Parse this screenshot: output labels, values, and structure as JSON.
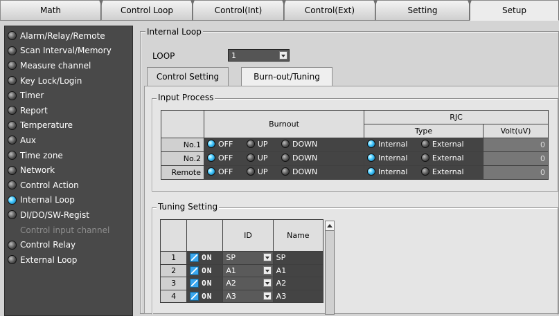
{
  "tabs": [
    {
      "label": "Math"
    },
    {
      "label": "Control Loop"
    },
    {
      "label": "Control(Int)"
    },
    {
      "label": "Control(Ext)"
    },
    {
      "label": "Setting"
    },
    {
      "label": "Setup"
    }
  ],
  "sidebar": {
    "items": [
      {
        "label": "Alarm/Relay/Remote",
        "icon": "status-led"
      },
      {
        "label": "Scan Interval/Memory",
        "icon": "status-led"
      },
      {
        "label": "Measure channel",
        "icon": "status-led"
      },
      {
        "label": "Key Lock/Login",
        "icon": "status-led"
      },
      {
        "label": "Timer",
        "icon": "status-led"
      },
      {
        "label": "Report",
        "icon": "status-led"
      },
      {
        "label": "Temperature",
        "icon": "status-led"
      },
      {
        "label": "Aux",
        "icon": "status-led"
      },
      {
        "label": "Time zone",
        "icon": "status-led"
      },
      {
        "label": "Network",
        "icon": "status-led"
      },
      {
        "label": "Control Action",
        "icon": "status-led"
      },
      {
        "label": "Internal Loop",
        "icon": "status-led-on"
      },
      {
        "label": "DI/DO/SW-Regist",
        "icon": "status-led"
      },
      {
        "label": "Control input channel",
        "icon": ""
      },
      {
        "label": "Control Relay",
        "icon": "status-led"
      },
      {
        "label": "External Loop",
        "icon": "status-led"
      }
    ]
  },
  "internal_loop": {
    "title": "Internal Loop",
    "loop_label": "LOOP",
    "loop_value": "1",
    "subtabs": [
      "Control Setting",
      "Burn-out/Tuning"
    ],
    "input_process": {
      "title": "Input Process",
      "burnout_header": "Burnout",
      "rjc_header": "RJC",
      "type_header": "Type",
      "volt_header": "Volt(uV)",
      "rows": [
        {
          "label": "No.1",
          "off": "OFF",
          "up": "UP",
          "down": "DOWN",
          "internal": "Internal",
          "external": "External",
          "volt": "0"
        },
        {
          "label": "No.2",
          "off": "OFF",
          "up": "UP",
          "down": "DOWN",
          "internal": "Internal",
          "external": "External",
          "volt": "0"
        },
        {
          "label": "Remote",
          "off": "OFF",
          "up": "UP",
          "down": "DOWN",
          "internal": "Internal",
          "external": "External",
          "volt": "0"
        }
      ]
    },
    "tuning": {
      "title": "Tuning Setting",
      "id_header": "ID",
      "name_header": "Name",
      "rows": [
        {
          "num": "1",
          "onoff": "ON",
          "id": "SP",
          "name": "SP"
        },
        {
          "num": "2",
          "onoff": "ON",
          "id": "A1",
          "name": "A1"
        },
        {
          "num": "3",
          "onoff": "ON",
          "id": "A2",
          "name": "A2"
        },
        {
          "num": "4",
          "onoff": "ON",
          "id": "A3",
          "name": "A3"
        }
      ]
    }
  },
  "colors": {
    "sidebar_bg": "#494949",
    "led_on": "#40c6ff",
    "panel_bg": "#d4d4d4",
    "table_dark": "#444444"
  }
}
